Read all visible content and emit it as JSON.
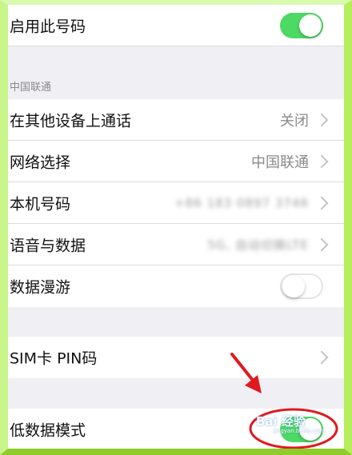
{
  "rows": {
    "enable_number": {
      "label": "启用此号码",
      "toggle": "on"
    },
    "wifi_calling": {
      "label": "在其他设备上通话",
      "value": "关闭"
    },
    "network": {
      "label": "网络选择",
      "value": "中国联通"
    },
    "my_number": {
      "label": "本机号码",
      "value": "+86 183 0897 3746"
    },
    "voice_data": {
      "label": "语音与数据",
      "value": "5G, 自动切换LTE"
    },
    "roaming": {
      "label": "数据漫游",
      "toggle": "off"
    },
    "sim_pin": {
      "label": "SIM卡 PIN码"
    },
    "low_data": {
      "label": "低数据模式",
      "toggle": "on"
    }
  },
  "section_header": "中国联通",
  "watermark": {
    "text": "Bai 经验",
    "sub": "jingyan.baidu.com"
  },
  "colors": {
    "toggle_on": "#4cd964",
    "annotation": "#e0191f",
    "frame": "#a9e84c"
  }
}
